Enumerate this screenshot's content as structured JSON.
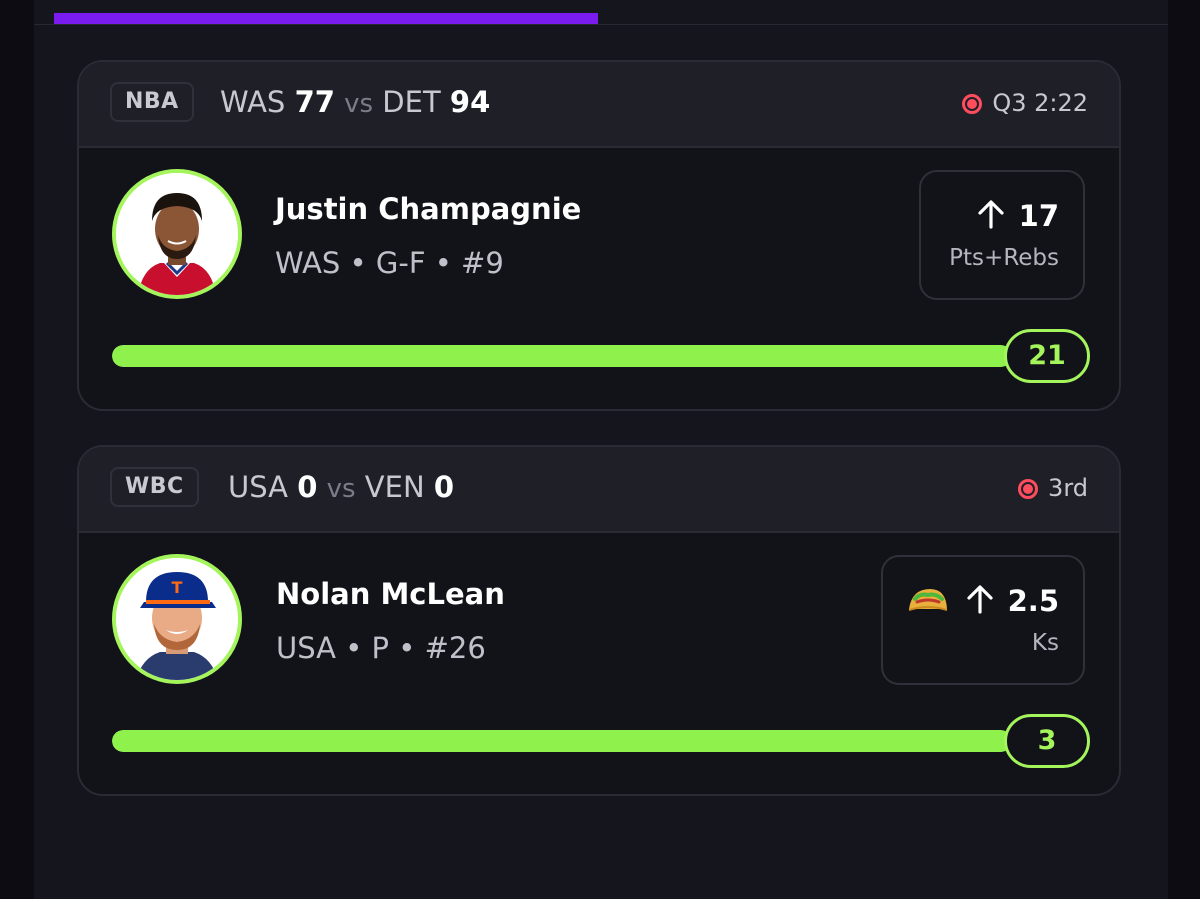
{
  "header": {
    "progress_fraction": 0.48
  },
  "cards": [
    {
      "league": "NBA",
      "away_team": "WAS",
      "away_score": "77",
      "vs": "vs",
      "home_team": "DET",
      "home_score": "94",
      "status": "Q3 2:22",
      "player": {
        "name": "Justin Champagnie",
        "meta": "WAS • G-F • #9"
      },
      "line": {
        "direction": "up-arrow-icon",
        "value": "17",
        "stat": "Pts+Rebs"
      },
      "current_value": "21",
      "progress_fraction": 1.0
    },
    {
      "league": "WBC",
      "away_team": "USA",
      "away_score": "0",
      "vs": "vs",
      "home_team": "VEN",
      "home_score": "0",
      "status": "3rd",
      "player": {
        "name": "Nolan McLean",
        "meta": "USA • P • #26"
      },
      "line": {
        "badge": "taco-icon",
        "direction": "up-arrow-icon",
        "value": "2.5",
        "stat": "Ks"
      },
      "current_value": "3",
      "progress_fraction": 1.0
    }
  ],
  "colors": {
    "accent_green": "#a4f45c",
    "live_red": "#ff4d5e",
    "top_progress_purple": "#7a1cf0"
  }
}
